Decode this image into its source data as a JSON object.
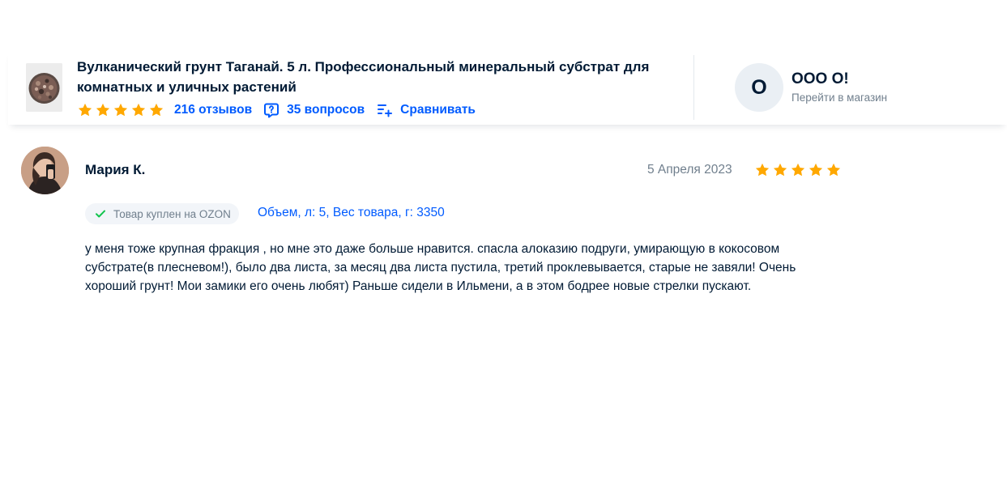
{
  "product": {
    "title": "Вулканический грунт Таганай. 5 л. Профессиональный минеральный субстрат для комнатных и уличных растений",
    "rating_stars": 5,
    "reviews_label": "216 отзывов",
    "questions_label": "35 вопросов",
    "compare_label": "Сравнивать"
  },
  "seller": {
    "avatar_letter": "O",
    "name": "OOO O!",
    "link_label": "Перейти в магазин"
  },
  "review": {
    "author": "Мария К.",
    "date": "5 Апреля 2023",
    "rating_stars": 5,
    "purchase_badge": "Товар куплен на OZON",
    "variant": "Объем, л: 5, Вес товара, г: 3350",
    "text": "у меня тоже крупная фракция , но мне это даже больше нравится. спасла алоказию подруги, умирающую в кокосовом субстрате(в плесневом!), было два листа, за месяц два листа пустила, третий проклевывается, старые не завяли! Очень хороший грунт! Мои замики его очень любят) Раньше сидели в Ильмени, а в этом бодрее новые стрелки пускают."
  },
  "colors": {
    "accent_blue": "#005bff",
    "star_yellow": "#ffa800",
    "text_dark": "#001a34",
    "text_gray": "#707f8d",
    "check_green": "#10c44c"
  },
  "icons": {
    "star": "star-icon",
    "questions": "question-bubble-icon",
    "compare": "compare-list-icon",
    "check": "check-icon"
  }
}
